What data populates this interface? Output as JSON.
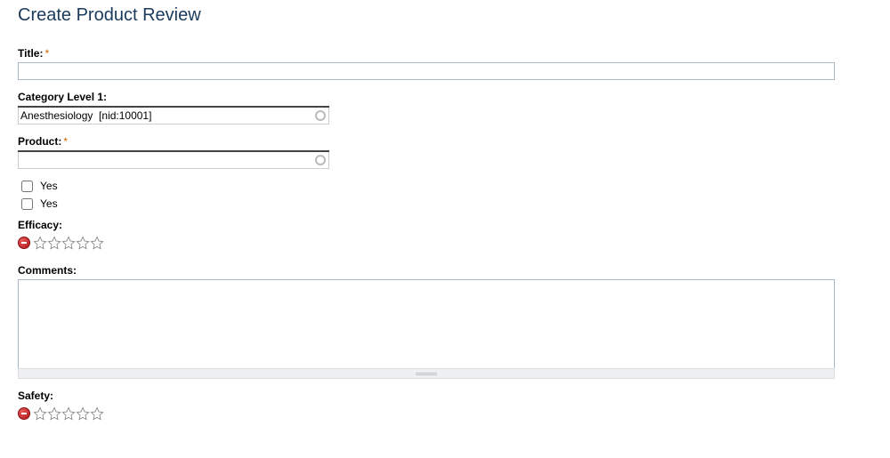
{
  "page": {
    "title": "Create Product Review"
  },
  "fields": {
    "title": {
      "label": "Title:",
      "value": ""
    },
    "category1": {
      "label": "Category Level 1:",
      "value": "Anesthesiology  [nid:10001]"
    },
    "product": {
      "label": "Product:",
      "value": ""
    },
    "checkbox1": {
      "label": "Yes",
      "checked": false
    },
    "checkbox2": {
      "label": "Yes",
      "checked": false
    },
    "efficacy": {
      "label": "Efficacy:",
      "value": 0,
      "max": 5
    },
    "comments": {
      "label": "Comments:",
      "value": ""
    },
    "safety": {
      "label": "Safety:",
      "value": 0,
      "max": 5
    }
  }
}
